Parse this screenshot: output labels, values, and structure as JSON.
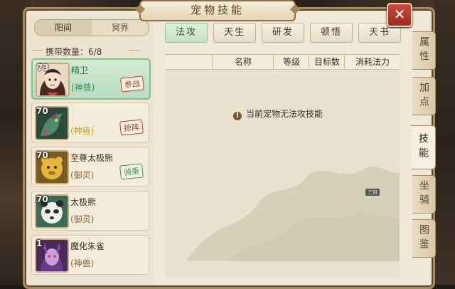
{
  "window": {
    "title": "宠物技能",
    "close_label": "✕"
  },
  "realm_toggle": {
    "options": [
      "阳间",
      "冥界"
    ],
    "selected": "阳间"
  },
  "carry": {
    "label": "携带数量：",
    "count": "6/8"
  },
  "pets": [
    {
      "level": "73",
      "name": "精卫",
      "type": "(神兽)",
      "stamp": "参战",
      "selected": true
    },
    {
      "level": "70",
      "name": "",
      "type": "(神兽)",
      "stamp": "掠阵",
      "selected": false
    },
    {
      "level": "70",
      "name": "至尊太极熊",
      "type": "(御灵)",
      "stamp": "骑乘",
      "selected": false
    },
    {
      "level": "70",
      "name": "太极熊",
      "type": "(御灵)",
      "stamp": "",
      "selected": false
    },
    {
      "level": "1",
      "name": "魔化朱雀",
      "type": "(神兽)",
      "stamp": "",
      "selected": false
    }
  ],
  "skill_tabs": [
    {
      "label": "法攻",
      "active": true
    },
    {
      "label": "天生",
      "active": false
    },
    {
      "label": "研发",
      "active": false
    },
    {
      "label": "顿悟",
      "active": false
    },
    {
      "label": "天书",
      "active": false
    }
  ],
  "table": {
    "columns": [
      "名称",
      "等级",
      "目标数",
      "消耗法力"
    ],
    "empty_message": "当前宠物无法攻技能"
  },
  "side_tabs": [
    {
      "label": "属性",
      "active": false
    },
    {
      "label": "加点",
      "active": false
    },
    {
      "label": "技能",
      "active": true
    },
    {
      "label": "坐骑",
      "active": false
    },
    {
      "label": "图鉴",
      "active": false
    }
  ],
  "page_tag": "三包",
  "colors": {
    "accent_green": "#7cc096",
    "frame_gold": "#a88a5c",
    "close_red": "#c23a30",
    "stamp_red": "#b0442e",
    "stamp_green": "#3a9a5a"
  }
}
